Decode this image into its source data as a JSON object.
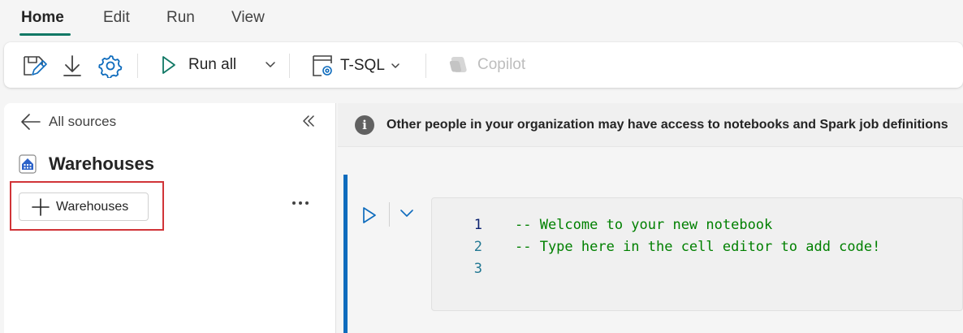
{
  "tabs": [
    {
      "label": "Home",
      "active": true
    },
    {
      "label": "Edit",
      "active": false
    },
    {
      "label": "Run",
      "active": false
    },
    {
      "label": "View",
      "active": false
    }
  ],
  "ribbon": {
    "icons": [
      "save-edit-icon",
      "download-icon",
      "settings-icon"
    ],
    "run_all_label": "Run all",
    "language_label": "T-SQL",
    "copilot_label": "Copilot"
  },
  "left_panel": {
    "back_label": "All sources",
    "title": "Warehouses",
    "add_button_label": "Warehouses",
    "more_label": "..."
  },
  "infobar": {
    "text": "Other people in your organization may have access to notebooks and Spark job definitions"
  },
  "cell": {
    "lines": [
      {
        "number": "1",
        "code": "-- Welcome to your new notebook"
      },
      {
        "number": "2",
        "code": "-- Type here in the cell editor to add code!"
      },
      {
        "number": "3",
        "code": ""
      }
    ]
  },
  "colors": {
    "accent": "#117865",
    "highlight": "#d13438",
    "cell_bar": "#0f6cbd",
    "comment": "#008000"
  }
}
